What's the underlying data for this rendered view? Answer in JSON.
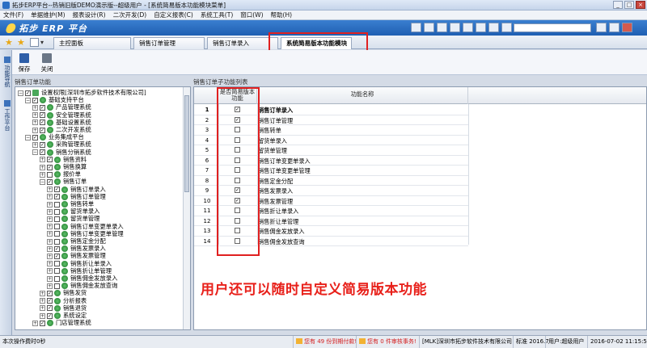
{
  "window": {
    "title": "拓步ERP平台--热销旧版DEMO演示版--超级用户 - [系统简易版本功能模块菜单]",
    "buttons": [
      "_",
      "□",
      "×"
    ]
  },
  "menu": [
    "文件(F)",
    "单据维护(M)",
    "报表设计(R)",
    "二次开发(D)",
    "自定义报表(C)",
    "系统工具(T)",
    "窗口(W)",
    "帮助(H)"
  ],
  "banner": {
    "logo_text": "拓步 ERP 平台"
  },
  "tabs": [
    {
      "label": "主控面板",
      "active": false
    },
    {
      "label": "销售订单管理",
      "active": false
    },
    {
      "label": "销售订单录入",
      "active": false
    },
    {
      "label": "系统简易版本功能模块",
      "active": true,
      "close": "×"
    }
  ],
  "toolbar": {
    "save_label": "保存",
    "close_label": "关闭"
  },
  "sidestrip": {
    "tab1": "功能导航",
    "tab2": "工作平台"
  },
  "left_panel": {
    "title": "销售订单功能",
    "nodes": [
      {
        "level": 0,
        "expander": "−",
        "checked": true,
        "icon": "folder",
        "label": "设置权限[深圳市拓步软件技术有限公司]"
      },
      {
        "level": 1,
        "expander": "−",
        "checked": true,
        "icon": "node",
        "label": "基础支持平台"
      },
      {
        "level": 2,
        "expander": "+",
        "checked": true,
        "icon": "node",
        "label": "产品管理系统"
      },
      {
        "level": 2,
        "expander": "+",
        "checked": true,
        "icon": "node",
        "label": "安全管理系统"
      },
      {
        "level": 2,
        "expander": "+",
        "checked": true,
        "icon": "node",
        "label": "基础设置系统"
      },
      {
        "level": 2,
        "expander": "+",
        "checked": true,
        "icon": "node",
        "label": "二次开发系统"
      },
      {
        "level": 1,
        "expander": "−",
        "checked": true,
        "icon": "node",
        "label": "业务集成平台"
      },
      {
        "level": 2,
        "expander": "+",
        "checked": true,
        "icon": "node",
        "label": "采购管理系统"
      },
      {
        "level": 2,
        "expander": "−",
        "checked": true,
        "icon": "node",
        "label": "销售分销系统"
      },
      {
        "level": 3,
        "expander": "+",
        "checked": true,
        "icon": "node",
        "label": "销售资料"
      },
      {
        "level": 3,
        "expander": "+",
        "checked": true,
        "icon": "node",
        "label": "销售换算"
      },
      {
        "level": 3,
        "expander": "+",
        "checked": false,
        "icon": "node",
        "label": "报价单"
      },
      {
        "level": 3,
        "expander": "−",
        "checked": true,
        "icon": "node",
        "label": "销售订单"
      },
      {
        "level": 4,
        "expander": "+",
        "checked": true,
        "icon": "node",
        "label": "销售订单录入"
      },
      {
        "level": 4,
        "expander": "+",
        "checked": true,
        "icon": "node",
        "label": "销售订单管理"
      },
      {
        "level": 4,
        "expander": "+",
        "checked": false,
        "icon": "node",
        "label": "销售转单"
      },
      {
        "level": 4,
        "expander": "+",
        "checked": false,
        "icon": "node",
        "label": "留货单录入"
      },
      {
        "level": 4,
        "expander": "+",
        "checked": false,
        "icon": "node",
        "label": "留货单管理"
      },
      {
        "level": 4,
        "expander": "+",
        "checked": false,
        "icon": "node",
        "label": "销售订单变更单录入"
      },
      {
        "level": 4,
        "expander": "+",
        "checked": false,
        "icon": "node",
        "label": "销售订单变更单管理"
      },
      {
        "level": 4,
        "expander": "+",
        "checked": false,
        "icon": "node",
        "label": "销售定金分配"
      },
      {
        "level": 4,
        "expander": "+",
        "checked": true,
        "icon": "node",
        "label": "销售发票录入"
      },
      {
        "level": 4,
        "expander": "+",
        "checked": true,
        "icon": "node",
        "label": "销售发票管理"
      },
      {
        "level": 4,
        "expander": "+",
        "checked": false,
        "icon": "node",
        "label": "销售折让单录入"
      },
      {
        "level": 4,
        "expander": "+",
        "checked": false,
        "icon": "node",
        "label": "销售折让单管理"
      },
      {
        "level": 4,
        "expander": "+",
        "checked": false,
        "icon": "node",
        "label": "销售佣金发放录入"
      },
      {
        "level": 4,
        "expander": "+",
        "checked": false,
        "icon": "node",
        "label": "销售佣金发放查询"
      },
      {
        "level": 3,
        "expander": "+",
        "checked": true,
        "icon": "node",
        "label": "销售发货"
      },
      {
        "level": 3,
        "expander": "+",
        "checked": true,
        "icon": "node",
        "label": "分析报表"
      },
      {
        "level": 3,
        "expander": "+",
        "checked": true,
        "icon": "node",
        "label": "销售退货"
      },
      {
        "level": 3,
        "expander": "+",
        "checked": true,
        "icon": "node",
        "label": "系统设定"
      },
      {
        "level": 2,
        "expander": "+",
        "checked": true,
        "icon": "node",
        "label": "门店管理系统"
      }
    ]
  },
  "grid": {
    "title": "销售订单子功能列表",
    "col_headers": {
      "check": "是否简易版本功能",
      "name": "功能名称"
    },
    "rows": [
      {
        "no": "1",
        "checked": true,
        "name": "销售订单录入",
        "bold": true
      },
      {
        "no": "2",
        "checked": true,
        "name": "销售订单管理",
        "bold": false
      },
      {
        "no": "3",
        "checked": false,
        "name": "销售转单",
        "bold": false
      },
      {
        "no": "4",
        "checked": false,
        "name": "留货单录入",
        "bold": false
      },
      {
        "no": "5",
        "checked": false,
        "name": "留货单管理",
        "bold": false
      },
      {
        "no": "6",
        "checked": false,
        "name": "销售订单变更单录入",
        "bold": false
      },
      {
        "no": "7",
        "checked": false,
        "name": "销售订单变更单管理",
        "bold": false
      },
      {
        "no": "8",
        "checked": false,
        "name": "销售定金分配",
        "bold": false
      },
      {
        "no": "9",
        "checked": true,
        "name": "销售发票录入",
        "bold": false
      },
      {
        "no": "10",
        "checked": true,
        "name": "销售发票管理",
        "bold": false
      },
      {
        "no": "11",
        "checked": false,
        "name": "销售折让单录入",
        "bold": false
      },
      {
        "no": "12",
        "checked": false,
        "name": "销售折让单管理",
        "bold": false
      },
      {
        "no": "13",
        "checked": false,
        "name": "销售佣金发放录入",
        "bold": false
      },
      {
        "no": "14",
        "checked": false,
        "name": "销售佣金发放查询",
        "bold": false
      }
    ]
  },
  "caption": "用户还可以随时自定义简易版本功能",
  "status": {
    "op_time": "本次操作费时0秒",
    "alert1": "您有 49 份到期付款!",
    "alert2": "您有 0 件审核事务!",
    "company": "[MLK]深圳市拓步软件技术有限公司",
    "version": "标准 2016.7",
    "user": "用户:超级用户",
    "datetime": "2016-07-02 11:15:57"
  },
  "colors": {
    "accent": "#2b6fc4",
    "highlight_box": "#e02020",
    "caption": "#e8201a"
  }
}
